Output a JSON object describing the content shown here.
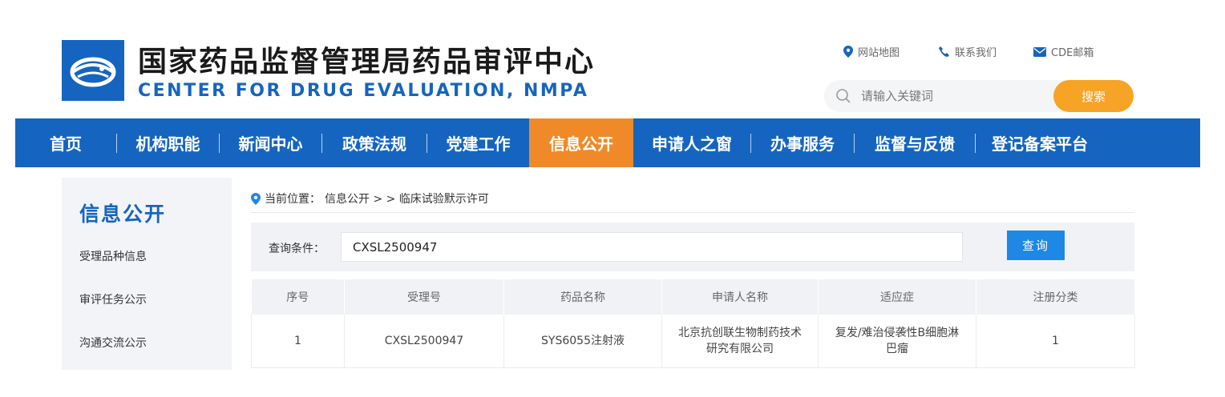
{
  "header": {
    "title_cn": "国家药品监督管理局药品审评中心",
    "title_en": "CENTER FOR DRUG EVALUATION, NMPA",
    "links": [
      {
        "label": "网站地图",
        "icon": "location-pin-icon"
      },
      {
        "label": "联系我们",
        "icon": "phone-icon"
      },
      {
        "label": "CDE邮箱",
        "icon": "mail-icon"
      }
    ],
    "search": {
      "placeholder": "请输入关键词",
      "button": "搜索"
    }
  },
  "nav": {
    "items": [
      {
        "label": "首页"
      },
      {
        "label": "机构职能"
      },
      {
        "label": "新闻中心"
      },
      {
        "label": "政策法规"
      },
      {
        "label": "党建工作"
      },
      {
        "label": "信息公开",
        "active": true
      },
      {
        "label": "申请人之窗"
      },
      {
        "label": "办事服务"
      },
      {
        "label": "监督与反馈"
      },
      {
        "label": "登记备案平台"
      }
    ]
  },
  "sidebar": {
    "title": "信息公开",
    "items": [
      {
        "label": "受理品种信息"
      },
      {
        "label": "审评任务公示"
      },
      {
        "label": "沟通交流公示"
      }
    ]
  },
  "breadcrumb": {
    "prefix": "当前位置：",
    "path": "信息公开 > > 临床试验默示许可"
  },
  "query": {
    "label": "查询条件：",
    "value": "CXSL2500947",
    "button": "查询"
  },
  "table": {
    "headers": [
      "序号",
      "受理号",
      "药品名称",
      "申请人名称",
      "适应症",
      "注册分类"
    ],
    "rows": [
      [
        "1",
        "CXSL2500947",
        "SYS6055注射液",
        "北京抗创联生物制药技术研究有限公司",
        "复发/难治侵袭性B细胞淋巴瘤",
        "1"
      ]
    ]
  },
  "colors": {
    "brand_blue": "#1565c0",
    "nav_active": "#f08a28",
    "search_button": "#f7a325",
    "query_button": "#1e88e5"
  }
}
